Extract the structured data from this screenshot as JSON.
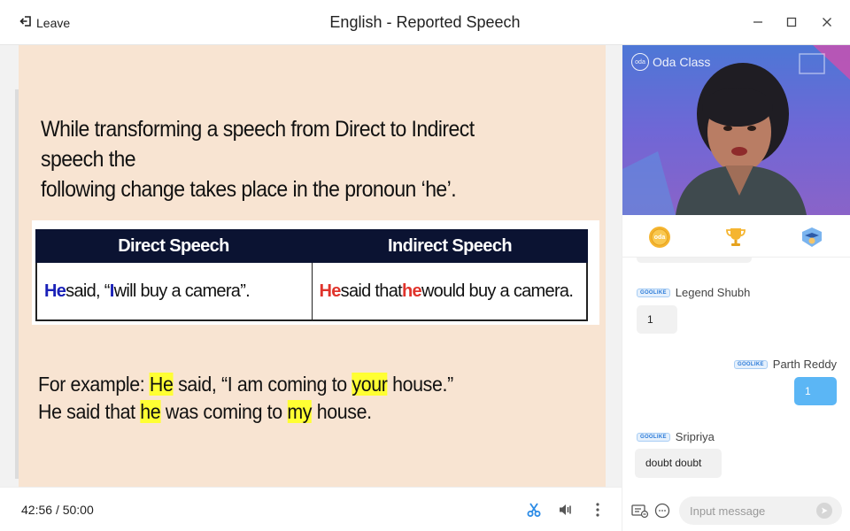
{
  "header": {
    "leave_label": "Leave",
    "title": "English - Reported Speech"
  },
  "slide": {
    "intro_line1": "While transforming a speech from Direct to Indirect speech the",
    "intro_line2": "following change takes place in the pronoun ‘he’.",
    "table": {
      "headers": [
        "Direct Speech",
        "Indirect Speech"
      ],
      "direct": {
        "p1": "He",
        "p2": " said, “",
        "p3": "I",
        "p4": " will buy a camera”."
      },
      "indirect": {
        "p1": "He",
        "p2": " said that ",
        "p3": "he",
        "p4": " would buy a camera."
      }
    },
    "example": {
      "l1_a": "For example: ",
      "l1_b": "He",
      "l1_c": " said, “I am coming to ",
      "l1_d": "your",
      "l1_e": " house.”",
      "l2_a": "He said that ",
      "l2_b": "he",
      "l2_c": " was coming to ",
      "l2_d": "my",
      "l2_e": " house."
    },
    "highlight_color": "#ffff33"
  },
  "player": {
    "elapsed": "42:56",
    "total": "/ 50:00"
  },
  "video": {
    "logo_text": "Oda Class",
    "logo_mark": "oda"
  },
  "awards": {
    "coin_label": "oda"
  },
  "chat": {
    "badge_label": "GOOLIKE",
    "messages": [
      {
        "sender": "Legend Shubh",
        "text": "1",
        "direction": "in"
      },
      {
        "sender": "Parth Reddy",
        "text": "1",
        "direction": "out"
      },
      {
        "sender": "Sripriya",
        "text": "doubt doubt",
        "direction": "in"
      }
    ],
    "input_placeholder": "Input message"
  },
  "colors": {
    "slide_bg": "#f8e4d2",
    "table_header_bg": "#0b1332",
    "direct_pronoun": "#1a21b8",
    "indirect_pronoun": "#e0342c",
    "outgoing_bubble": "#5bb6f5",
    "accent_icon": "#2b8be6"
  }
}
